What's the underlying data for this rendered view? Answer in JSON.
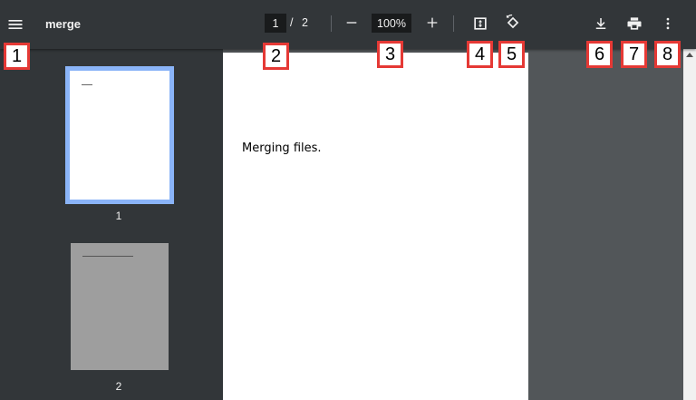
{
  "toolbar": {
    "title": "merge",
    "current_page": "1",
    "page_separator": "/",
    "total_pages": "2",
    "zoom_value": "100%"
  },
  "sidebar": {
    "thumbnails": [
      {
        "label": "1",
        "selected": true
      },
      {
        "label": "2",
        "selected": false
      }
    ]
  },
  "viewer": {
    "page_text": "Merging files."
  },
  "annotations": [
    "1",
    "2",
    "3",
    "4",
    "5",
    "6",
    "7",
    "8"
  ],
  "colors": {
    "toolbar_bg": "#323639",
    "viewer_bg": "#525659",
    "thumb_selected_border": "#8ab4f8",
    "badge_border": "#e53935"
  },
  "icons": {
    "menu": "hamburger-icon",
    "zoom_out": "minus-icon",
    "zoom_in": "plus-icon",
    "fit": "fit-to-page-icon",
    "rotate": "rotate-icon",
    "download": "download-icon",
    "print": "print-icon",
    "more": "more-vert-icon"
  }
}
